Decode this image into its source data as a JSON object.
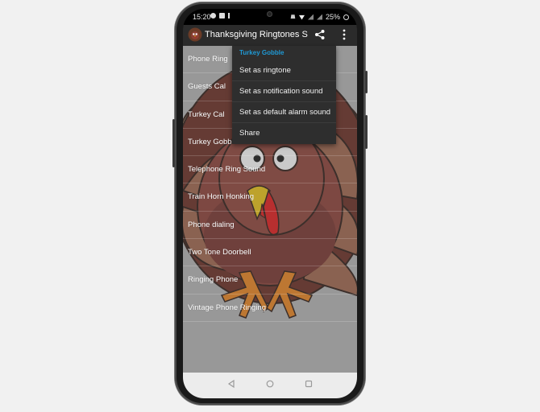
{
  "status_bar": {
    "time": "15:20",
    "battery": "25%"
  },
  "app_bar": {
    "title": "Thanksgiving Ringtones So..."
  },
  "list": {
    "items": [
      {
        "label": "Phone Ring"
      },
      {
        "label": "Guests Cal"
      },
      {
        "label": "Turkey Cal"
      },
      {
        "label": "Turkey Gobble"
      },
      {
        "label": "Telephone Ring Sound"
      },
      {
        "label": "Train Horn Honking"
      },
      {
        "label": "Phone dialing"
      },
      {
        "label": "Two Tone Doorbell"
      },
      {
        "label": "Ringing Phone"
      },
      {
        "label": "Vintage Phone Ringing"
      }
    ]
  },
  "context_menu": {
    "title": "Turkey Gobble",
    "items": [
      {
        "label": "Set as ringtone"
      },
      {
        "label": "Set as notification sound"
      },
      {
        "label": "Set as default alarm sound"
      },
      {
        "label": "Share"
      }
    ]
  },
  "colors": {
    "accent": "#1f9ad6",
    "app_bar": "#2b2b2b",
    "menu_bg": "#2e2e2e"
  }
}
